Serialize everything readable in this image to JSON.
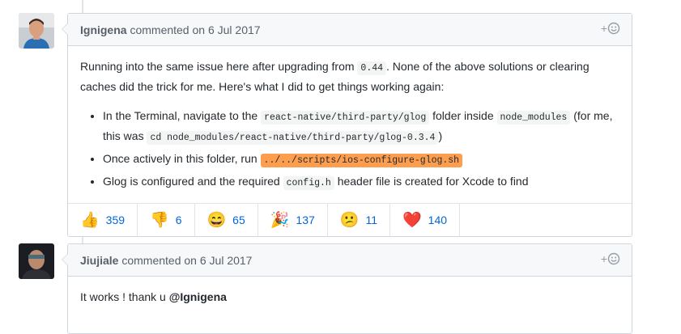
{
  "comments": [
    {
      "author": "Ignigena",
      "action": "commented on",
      "date": "6 Jul 2017",
      "add_reaction": "+",
      "intro_a": "Running into the same issue here after upgrading from ",
      "intro_code": "0.44",
      "intro_b": ". None of the above solutions or clearing caches did the trick for me. Here's what I did to get things working again:",
      "steps": [
        {
          "t1": "In the Terminal, navigate to the ",
          "c1": "react-native/third-party/glog",
          "t2": " folder inside ",
          "c2": "node_modules",
          "t3": " (for me, this was ",
          "c3": "cd node_modules/react-native/third-party/glog-0.3.4",
          "t4": ")"
        },
        {
          "t1": "Once actively in this folder, run ",
          "c1": "../../scripts/ios-configure-glog.sh"
        },
        {
          "t1": "Glog is configured and the required ",
          "c1": "config.h",
          "t2": " header file is created for Xcode to find"
        }
      ],
      "reactions": [
        {
          "icon": "thumbs-up",
          "emoji": "👍",
          "count": "359"
        },
        {
          "icon": "thumbs-down",
          "emoji": "👎",
          "count": "6"
        },
        {
          "icon": "laugh",
          "emoji": "😄",
          "count": "65"
        },
        {
          "icon": "hooray",
          "emoji": "🎉",
          "count": "137"
        },
        {
          "icon": "confused",
          "emoji": "😕",
          "count": "11"
        },
        {
          "icon": "heart",
          "emoji": "❤️",
          "count": "140"
        }
      ]
    },
    {
      "author": "Jiujiale",
      "action": "commented on",
      "date": "6 Jul 2017",
      "add_reaction": "+",
      "body": "It works ! thank u ",
      "mention": "@Ignigena"
    }
  ],
  "colors": {
    "link": "#0366d6",
    "highlight": "#fd9e4e",
    "border": "#d1d5da",
    "header_bg": "#f6f8fa"
  }
}
